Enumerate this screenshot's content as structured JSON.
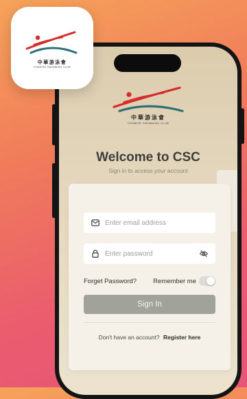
{
  "app_icon": {
    "logo_chinese": "中華游泳會",
    "logo_english": "CHINESE SWIMMING CLUB"
  },
  "screen": {
    "logo_chinese": "中華游泳會",
    "logo_english": "CHINESE SWIMMING CLUB",
    "title": "Welcome to CSC",
    "subtitle": "Sign in to access your account"
  },
  "form": {
    "email_placeholder": "Enter email address",
    "password_placeholder": "Enter password",
    "forgot_label": "Forget Password?",
    "remember_label": "Remember me",
    "remember_on": false,
    "signin_label": "Sign In",
    "register_prompt": "Don't have an account?",
    "register_link": "Register here"
  },
  "colors": {
    "background_gradient": [
      "#f6a35a",
      "#e85478"
    ],
    "button": "#a1a39a",
    "logo_red": "#d62b2b",
    "logo_teal": "#2f6f73"
  },
  "icons": [
    "envelope-icon",
    "lock-icon",
    "eye-off-icon"
  ]
}
